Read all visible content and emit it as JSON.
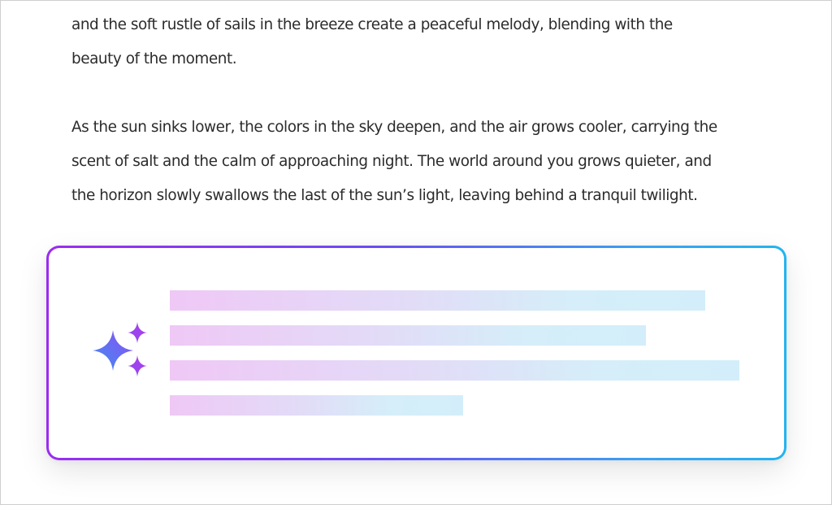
{
  "document": {
    "paragraphs": [
      {
        "lines": [
          "and the soft rustle of sails in the breeze create a peaceful melody, blending with the",
          "beauty of the moment."
        ]
      },
      {
        "lines": [
          "As the sun sinks lower, the colors in the sky deepen, and the air grows cooler, carrying the",
          "scent of salt and the calm of approaching night. The world around you grows quieter, and",
          "the horizon slowly swallows the last of the sun’s light, leaving behind a tranquil twilight."
        ]
      }
    ]
  },
  "ai_card": {
    "icon": "sparkle-icon",
    "border_gradient": [
      "#9b2cf0",
      "#6a4df2",
      "#3aa0f2",
      "#22b4ef"
    ],
    "placeholder_gradient": [
      "#efc8f6",
      "#e2dcf7",
      "#d5eef9",
      "#d3eefa"
    ],
    "placeholder_line_count": 4
  }
}
